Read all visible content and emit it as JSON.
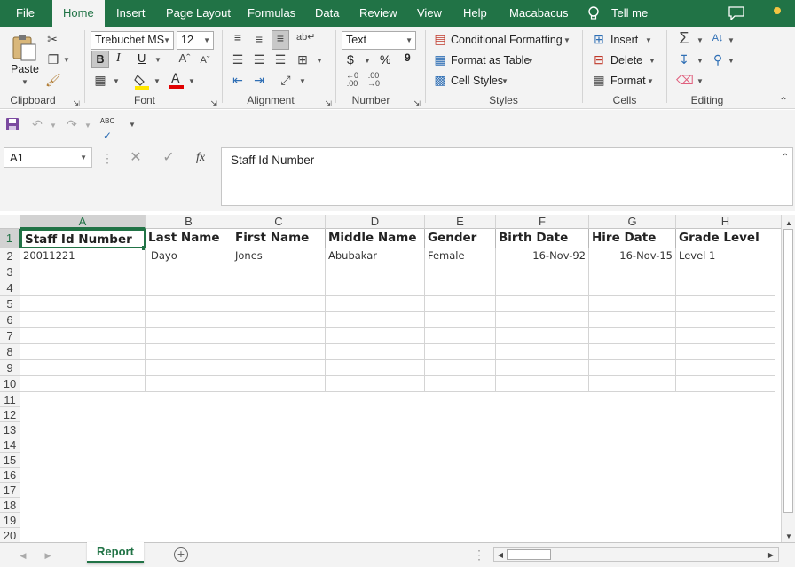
{
  "menu": {
    "file": "File",
    "home": "Home",
    "insert": "Insert",
    "page_layout": "Page Layout",
    "formulas": "Formulas",
    "data": "Data",
    "review": "Review",
    "view": "View",
    "help": "Help",
    "macabacus": "Macabacus",
    "tell_me": "Tell me"
  },
  "ribbon": {
    "clipboard": {
      "paste": "Paste",
      "label": "Clipboard"
    },
    "font": {
      "name": "Trebuchet MS",
      "size": "12",
      "bold": "B",
      "italic": "I",
      "underline": "U",
      "label": "Font"
    },
    "alignment": {
      "label": "Alignment"
    },
    "number": {
      "format": "Text",
      "currency": "$",
      "percent": "%",
      "comma": "9",
      "label": "Number"
    },
    "styles": {
      "conditional": "Conditional Formatting",
      "format_table": "Format as Table",
      "cell_styles": "Cell Styles",
      "label": "Styles"
    },
    "cells": {
      "insert": "Insert",
      "delete": "Delete",
      "format": "Format",
      "label": "Cells"
    },
    "editing": {
      "label": "Editing"
    }
  },
  "formula_bar": {
    "name_box": "A1",
    "fx": "fx",
    "content": "Staff Id Number"
  },
  "columns": [
    "A",
    "B",
    "C",
    "D",
    "E",
    "F",
    "G",
    "H"
  ],
  "rows": [
    "1",
    "2",
    "3",
    "4",
    "5",
    "6",
    "7",
    "8",
    "9",
    "10",
    "11",
    "12",
    "13",
    "14",
    "15",
    "16",
    "17",
    "18",
    "19",
    "20"
  ],
  "table": {
    "headers": [
      "Staff Id Number",
      "Last Name",
      "First Name",
      "Middle Name",
      "Gender",
      "Birth Date",
      "Hire Date",
      "Grade Level"
    ],
    "row2": [
      "20011221",
      "Dayo",
      "Jones",
      "Abubakar",
      "Female",
      "16-Nov-92",
      "16-Nov-15",
      "Level 1"
    ]
  },
  "sheet_tab": "Report",
  "colors": {
    "accent": "#217346",
    "ribbon_bg": "#f3f3f3"
  }
}
